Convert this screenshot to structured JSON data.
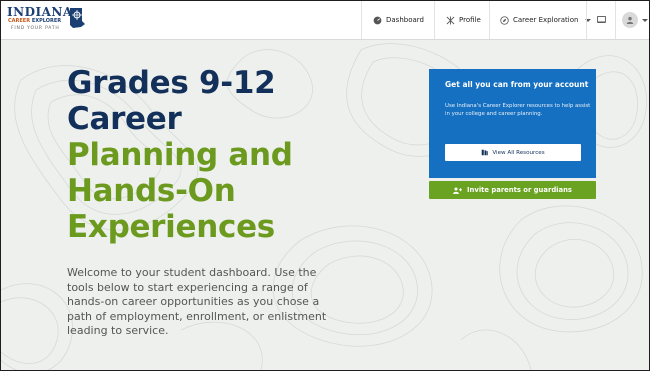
{
  "logo": {
    "main": "INDIANA",
    "sub_orange": "CAREER",
    "sub_blue": "EXPLORER",
    "tagline": "FIND YOUR PATH"
  },
  "nav": {
    "dashboard": "Dashboard",
    "profile": "Profile",
    "career_exploration": "Career Exploration"
  },
  "hero": {
    "title_dark": [
      "Grades 9-12",
      "Career"
    ],
    "title_green": [
      "Planning and",
      "Hands-On",
      "Experiences"
    ],
    "intro": "Welcome to your student dashboard. Use the tools below to start experiencing a range of hands-on career opportunities as you chose a path of employment, enrollment, or enlistment leading to service."
  },
  "card": {
    "title": "Get all you can from your account",
    "text": "Use Indiana's Career Explorer resources to help assist in your college and career planning.",
    "button": "View All Resources"
  },
  "invite_button": "Invite parents or guardians",
  "colors": {
    "navy": "#12305a",
    "green": "#6c9a1e",
    "card_blue": "#1570c1",
    "button_green": "#6aa321"
  },
  "icons": [
    "dashboard-icon",
    "profile-icon",
    "compass-icon",
    "chevron-down-icon",
    "messages-icon",
    "user-icon",
    "resources-icon",
    "add-user-icon"
  ]
}
